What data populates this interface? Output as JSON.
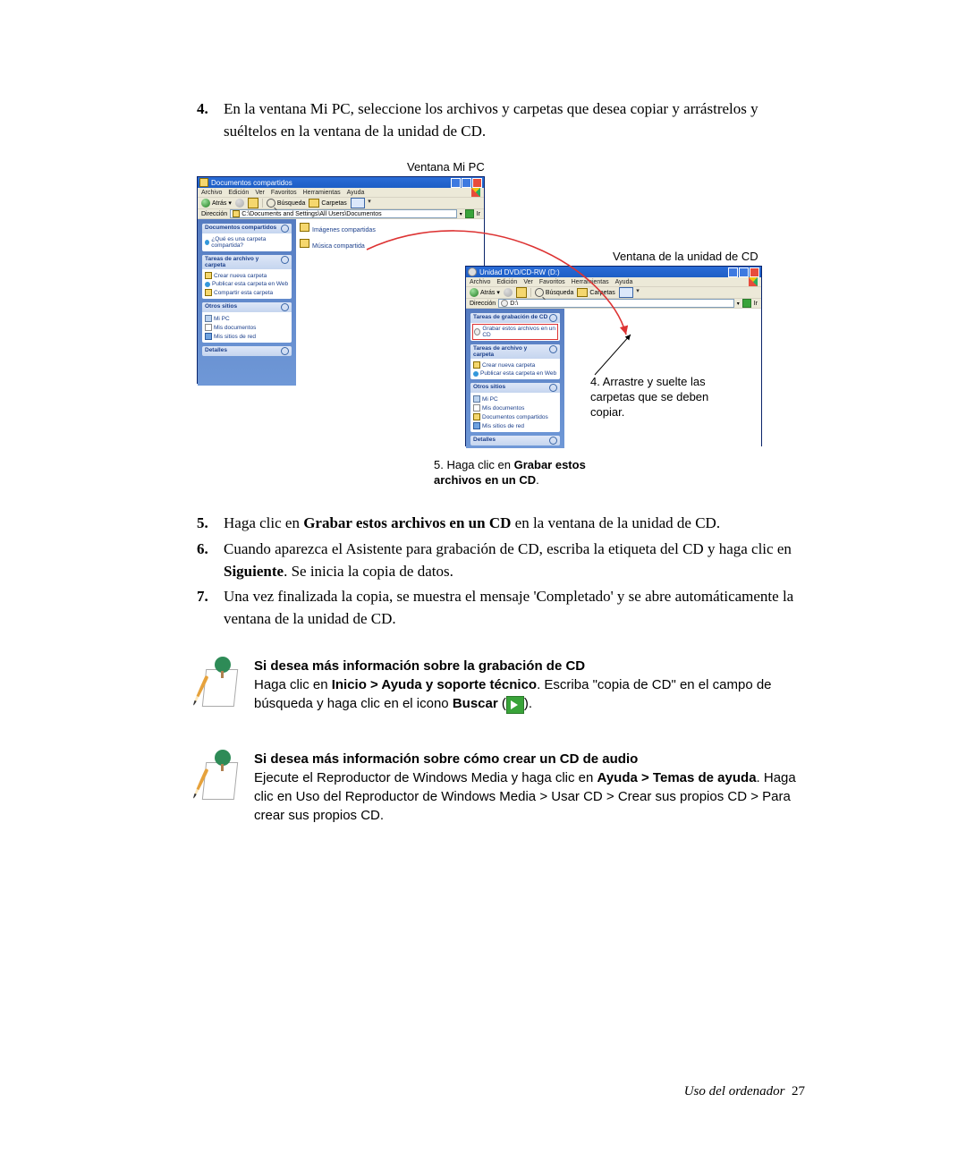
{
  "steps": {
    "s4": "En la ventana Mi PC, seleccione los archivos y carpetas que desea copiar y arrástrelos y suéltelos en la ventana de la unidad de CD.",
    "s5_pre": "Haga clic en ",
    "s5_b": "Grabar estos archivos en un CD",
    "s5_post": " en la ventana de la unidad de CD.",
    "s6_pre": "Cuando aparezca el Asistente para grabación de CD, escriba la etiqueta del CD y haga clic en ",
    "s6_b": "Siguiente",
    "s6_post": ". Se inicia la copia de datos.",
    "s7": "Una vez finalizada la copia, se muestra el mensaje 'Completado' y se abre automáticamente la ventana de la unidad de CD."
  },
  "figcaps": {
    "mipc": "Ventana Mi PC",
    "cd": "Ventana de la unidad de CD"
  },
  "win1": {
    "title": "Documentos compartidos",
    "menus": [
      "Archivo",
      "Edición",
      "Ver",
      "Favoritos",
      "Herramientas",
      "Ayuda"
    ],
    "tb_back": "Atrás",
    "tb_search": "Búsqueda",
    "tb_folders": "Carpetas",
    "addr_label": "Dirección",
    "addr_path": "C:\\Documents and Settings\\All Users\\Documentos",
    "addr_go": "Ir",
    "panels": {
      "p1_head": "Documentos compartidos",
      "p1_item": "¿Qué es una carpeta compartida?",
      "p2_head": "Tareas de archivo y carpeta",
      "p2_items": [
        "Crear nueva carpeta",
        "Publicar esta carpeta en Web",
        "Compartir esta carpeta"
      ],
      "p3_head": "Otros sitios",
      "p3_items": [
        "Mi PC",
        "Mis documentos",
        "Mis sitios de red"
      ],
      "p4_head": "Detalles"
    },
    "content": [
      "Imágenes compartidas",
      "Música compartida"
    ]
  },
  "win2": {
    "title": "Unidad DVD/CD-RW (D:)",
    "menus": [
      "Archivo",
      "Edición",
      "Ver",
      "Favoritos",
      "Herramientas",
      "Ayuda"
    ],
    "tb_back": "Atrás",
    "tb_search": "Búsqueda",
    "tb_folders": "Carpetas",
    "addr_label": "Dirección",
    "addr_path": "D:\\",
    "addr_go": "Ir",
    "panels": {
      "p1_head": "Tareas de grabación de CD",
      "p1_items": [
        "Grabar estos archivos en un CD"
      ],
      "p2_head": "Tareas de archivo y carpeta",
      "p2_items": [
        "Crear nueva carpeta",
        "Publicar esta carpeta en Web"
      ],
      "p3_head": "Otros sitios",
      "p3_items": [
        "Mi PC",
        "Mis documentos",
        "Documentos compartidos",
        "Mis sitios de red"
      ],
      "p4_head": "Detalles"
    }
  },
  "callouts": {
    "drag": "4. Arrastre y suelte las carpetas que se deben copiar.",
    "burn_pre": "5. Haga clic en ",
    "burn_b": "Grabar estos archivos en un CD",
    "burn_post": "."
  },
  "tip1": {
    "h": "Si desea más información sobre la grabación de CD",
    "t1": "Haga clic en ",
    "b1": "Inicio > Ayuda y soporte técnico",
    "t2": ". Escriba \"copia de CD\" en el campo de búsqueda y haga clic en el icono ",
    "b2": "Buscar",
    "t3": " (",
    "t4": ")."
  },
  "tip2": {
    "h": "Si desea más información sobre cómo crear un CD de audio",
    "t1": "Ejecute el Reproductor de Windows Media y haga clic en ",
    "b1": "Ayuda > Temas de ayuda",
    "t2": ". Haga clic en Uso del Reproductor de Windows Media > Usar CD > Crear sus propios CD > Para crear sus propios CD."
  },
  "footer": {
    "text": "Uso del ordenador",
    "page": "27"
  }
}
